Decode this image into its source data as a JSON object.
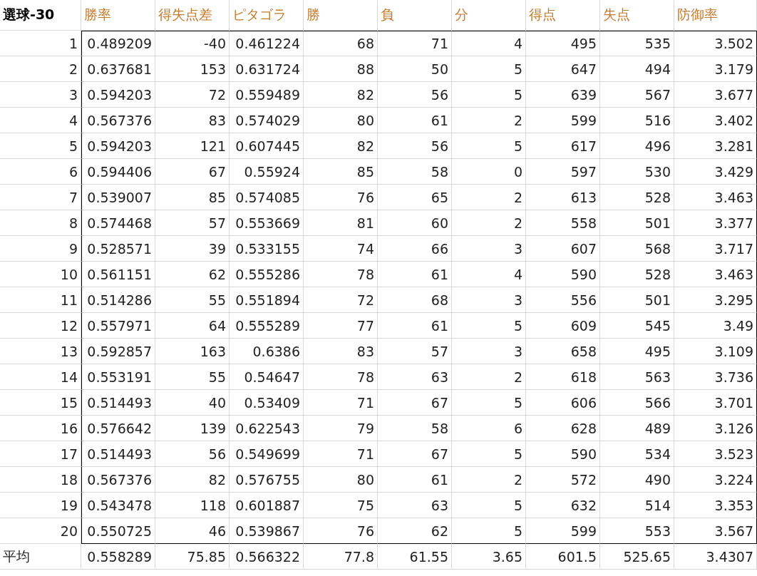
{
  "columns": [
    "選球-30",
    "勝率",
    "得失点差",
    "ピタゴラ",
    "勝",
    "負",
    "分",
    "得点",
    "失点",
    "防御率"
  ],
  "rows": [
    [
      "1",
      "0.489209",
      "-40",
      "0.461224",
      "68",
      "71",
      "4",
      "495",
      "535",
      "3.502"
    ],
    [
      "2",
      "0.637681",
      "153",
      "0.631724",
      "88",
      "50",
      "5",
      "647",
      "494",
      "3.179"
    ],
    [
      "3",
      "0.594203",
      "72",
      "0.559489",
      "82",
      "56",
      "5",
      "639",
      "567",
      "3.677"
    ],
    [
      "4",
      "0.567376",
      "83",
      "0.574029",
      "80",
      "61",
      "2",
      "599",
      "516",
      "3.402"
    ],
    [
      "5",
      "0.594203",
      "121",
      "0.607445",
      "82",
      "56",
      "5",
      "617",
      "496",
      "3.281"
    ],
    [
      "6",
      "0.594406",
      "67",
      "0.55924",
      "85",
      "58",
      "0",
      "597",
      "530",
      "3.429"
    ],
    [
      "7",
      "0.539007",
      "85",
      "0.574085",
      "76",
      "65",
      "2",
      "613",
      "528",
      "3.463"
    ],
    [
      "8",
      "0.574468",
      "57",
      "0.553669",
      "81",
      "60",
      "2",
      "558",
      "501",
      "3.377"
    ],
    [
      "9",
      "0.528571",
      "39",
      "0.533155",
      "74",
      "66",
      "3",
      "607",
      "568",
      "3.717"
    ],
    [
      "10",
      "0.561151",
      "62",
      "0.555286",
      "78",
      "61",
      "4",
      "590",
      "528",
      "3.463"
    ],
    [
      "11",
      "0.514286",
      "55",
      "0.551894",
      "72",
      "68",
      "3",
      "556",
      "501",
      "3.295"
    ],
    [
      "12",
      "0.557971",
      "64",
      "0.555289",
      "77",
      "61",
      "5",
      "609",
      "545",
      "3.49"
    ],
    [
      "13",
      "0.592857",
      "163",
      "0.6386",
      "83",
      "57",
      "3",
      "658",
      "495",
      "3.109"
    ],
    [
      "14",
      "0.553191",
      "55",
      "0.54647",
      "78",
      "63",
      "2",
      "618",
      "563",
      "3.736"
    ],
    [
      "15",
      "0.514493",
      "40",
      "0.53409",
      "71",
      "67",
      "5",
      "606",
      "566",
      "3.701"
    ],
    [
      "16",
      "0.576642",
      "139",
      "0.622543",
      "79",
      "58",
      "6",
      "628",
      "489",
      "3.126"
    ],
    [
      "17",
      "0.514493",
      "56",
      "0.549699",
      "71",
      "67",
      "5",
      "590",
      "534",
      "3.523"
    ],
    [
      "18",
      "0.567376",
      "82",
      "0.576755",
      "80",
      "61",
      "2",
      "572",
      "490",
      "3.224"
    ],
    [
      "19",
      "0.543478",
      "118",
      "0.601887",
      "75",
      "63",
      "5",
      "632",
      "514",
      "3.353"
    ],
    [
      "20",
      "0.550725",
      "46",
      "0.539867",
      "76",
      "62",
      "5",
      "599",
      "553",
      "3.567"
    ]
  ],
  "average": [
    "平均",
    "0.558289",
    "75.85",
    "0.566322",
    "77.8",
    "61.55",
    "3.65",
    "601.5",
    "525.65",
    "3.4307"
  ]
}
